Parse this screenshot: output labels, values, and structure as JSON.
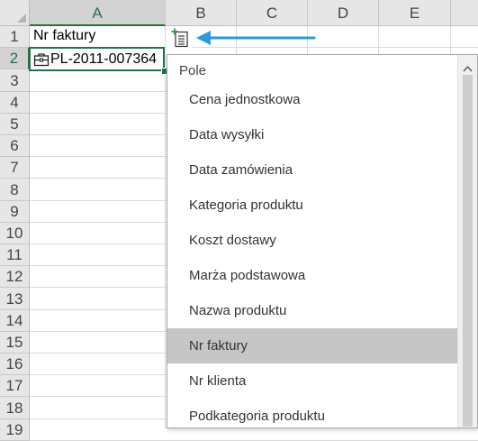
{
  "columns": [
    "A",
    "B",
    "C",
    "D",
    "E"
  ],
  "rows": [
    "1",
    "2",
    "3",
    "4",
    "5",
    "6",
    "7",
    "8",
    "9",
    "10",
    "11",
    "12",
    "13",
    "14",
    "15",
    "16",
    "17",
    "18",
    "19"
  ],
  "cells": {
    "a1": "Nr faktury",
    "a2": "PL-2011-007364"
  },
  "dropdown": {
    "header": "Pole",
    "items": [
      {
        "label": "Cena jednostkowa"
      },
      {
        "label": "Data wysyłki"
      },
      {
        "label": "Data zamówienia"
      },
      {
        "label": "Kategoria produktu"
      },
      {
        "label": "Koszt dostawy"
      },
      {
        "label": "Marża podstawowa"
      },
      {
        "label": "Nazwa produktu"
      },
      {
        "label": "Nr faktury",
        "selected": true
      },
      {
        "label": "Nr klienta"
      },
      {
        "label": "Podkategoria produktu"
      }
    ]
  },
  "icons": {
    "flash_fill": "insert-data-icon",
    "data_type": "data-type-icon",
    "arrow": "arrow-left-icon",
    "scroll_up": "chevron-up-icon"
  },
  "colors": {
    "accent": "#217346",
    "arrow": "#2e9bd6",
    "selected_item": "#c6c6c6"
  }
}
